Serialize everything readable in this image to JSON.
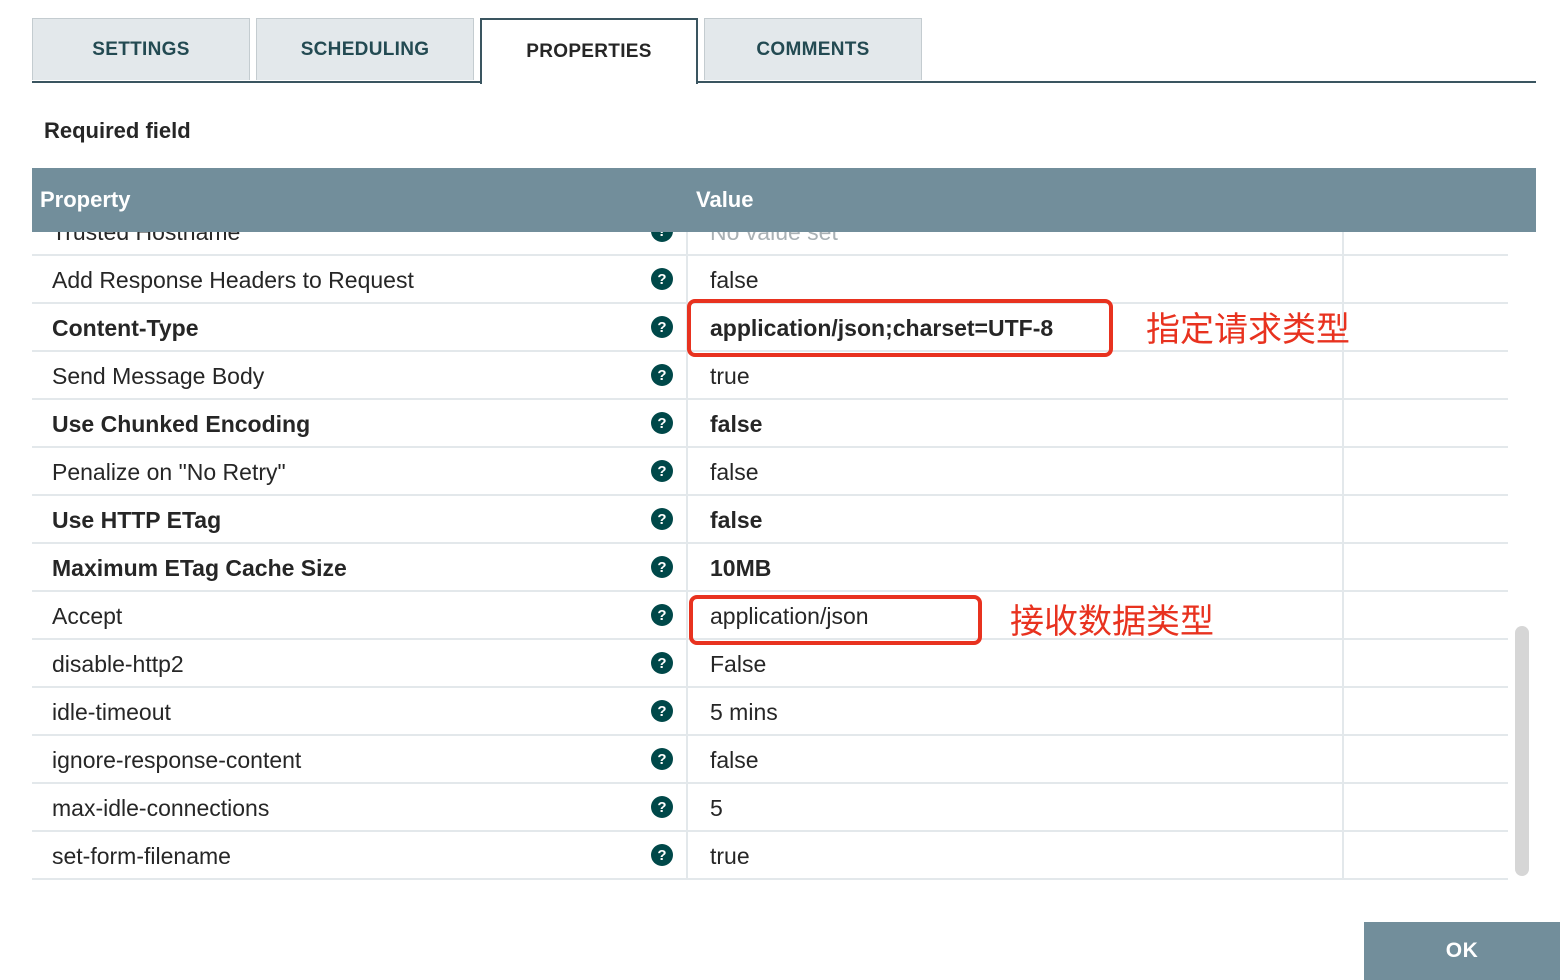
{
  "tabs": [
    {
      "label": "SETTINGS",
      "active": false
    },
    {
      "label": "SCHEDULING",
      "active": false
    },
    {
      "label": "PROPERTIES",
      "active": true
    },
    {
      "label": "COMMENTS",
      "active": false
    }
  ],
  "required_label": "Required field",
  "table": {
    "headers": {
      "property": "Property",
      "value": "Value"
    },
    "rows": [
      {
        "property": "Trusted Hostname",
        "value": "No value set",
        "bold": false,
        "muted": true
      },
      {
        "property": "Add Response Headers to Request",
        "value": "false",
        "bold": false
      },
      {
        "property": "Content-Type",
        "value": "application/json;charset=UTF-8",
        "bold": true
      },
      {
        "property": "Send Message Body",
        "value": "true",
        "bold": false
      },
      {
        "property": "Use Chunked Encoding",
        "value": "false",
        "bold": true
      },
      {
        "property": "Penalize on \"No Retry\"",
        "value": "false",
        "bold": false
      },
      {
        "property": "Use HTTP ETag",
        "value": "false",
        "bold": true
      },
      {
        "property": "Maximum ETag Cache Size",
        "value": "10MB",
        "bold": true
      },
      {
        "property": "Accept",
        "value": "application/json",
        "bold": false
      },
      {
        "property": "disable-http2",
        "value": "False",
        "bold": false
      },
      {
        "property": "idle-timeout",
        "value": "5 mins",
        "bold": false
      },
      {
        "property": "ignore-response-content",
        "value": "false",
        "bold": false
      },
      {
        "property": "max-idle-connections",
        "value": "5",
        "bold": false
      },
      {
        "property": "set-form-filename",
        "value": "true",
        "bold": false
      }
    ],
    "help_glyph": "?"
  },
  "annotations": {
    "content_type_note": "指定请求类型",
    "accept_note": "接收数据类型",
    "color": "#e8321f"
  },
  "buttons": {
    "ok": "OK"
  },
  "colors": {
    "header_bg": "#728e9b",
    "help_icon": "#004849",
    "tab_bg": "#e3e8eb"
  }
}
